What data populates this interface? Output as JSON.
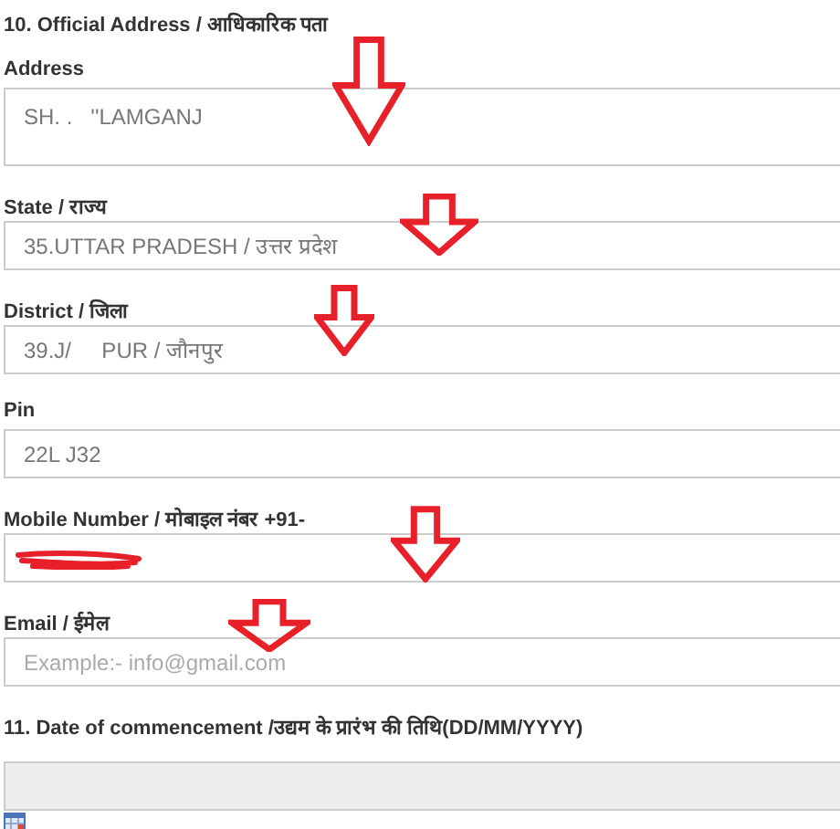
{
  "section_10": {
    "heading": "10. Official Address / आधिकारिक पता",
    "fields": [
      {
        "label": "Address",
        "kind": "textarea",
        "value": "SH. .   ''LAMGANJ",
        "arrow": true
      },
      {
        "label": "State / राज्य",
        "kind": "input",
        "value": "35.UTTAR PRADESH / उत्तर प्रदेश",
        "arrow": true
      },
      {
        "label": "District / जिला",
        "kind": "input",
        "value": "39.J/     PUR / जौनपुर",
        "arrow": true
      },
      {
        "label": "Pin",
        "kind": "input",
        "value": "22L J32"
      },
      {
        "label": "Mobile Number / मोबाइल नंबर +91-",
        "kind": "input",
        "redacted": true,
        "arrow": true
      },
      {
        "label": "Email / ईमेल",
        "kind": "input",
        "placeholder": "Example:- info@gmail.com",
        "arrow": true
      }
    ]
  },
  "section_11": {
    "heading": "11. Date of commencement /उद्यम के प्रारंभ की तिथि(DD/MM/YYYY)",
    "disabled": true
  }
}
